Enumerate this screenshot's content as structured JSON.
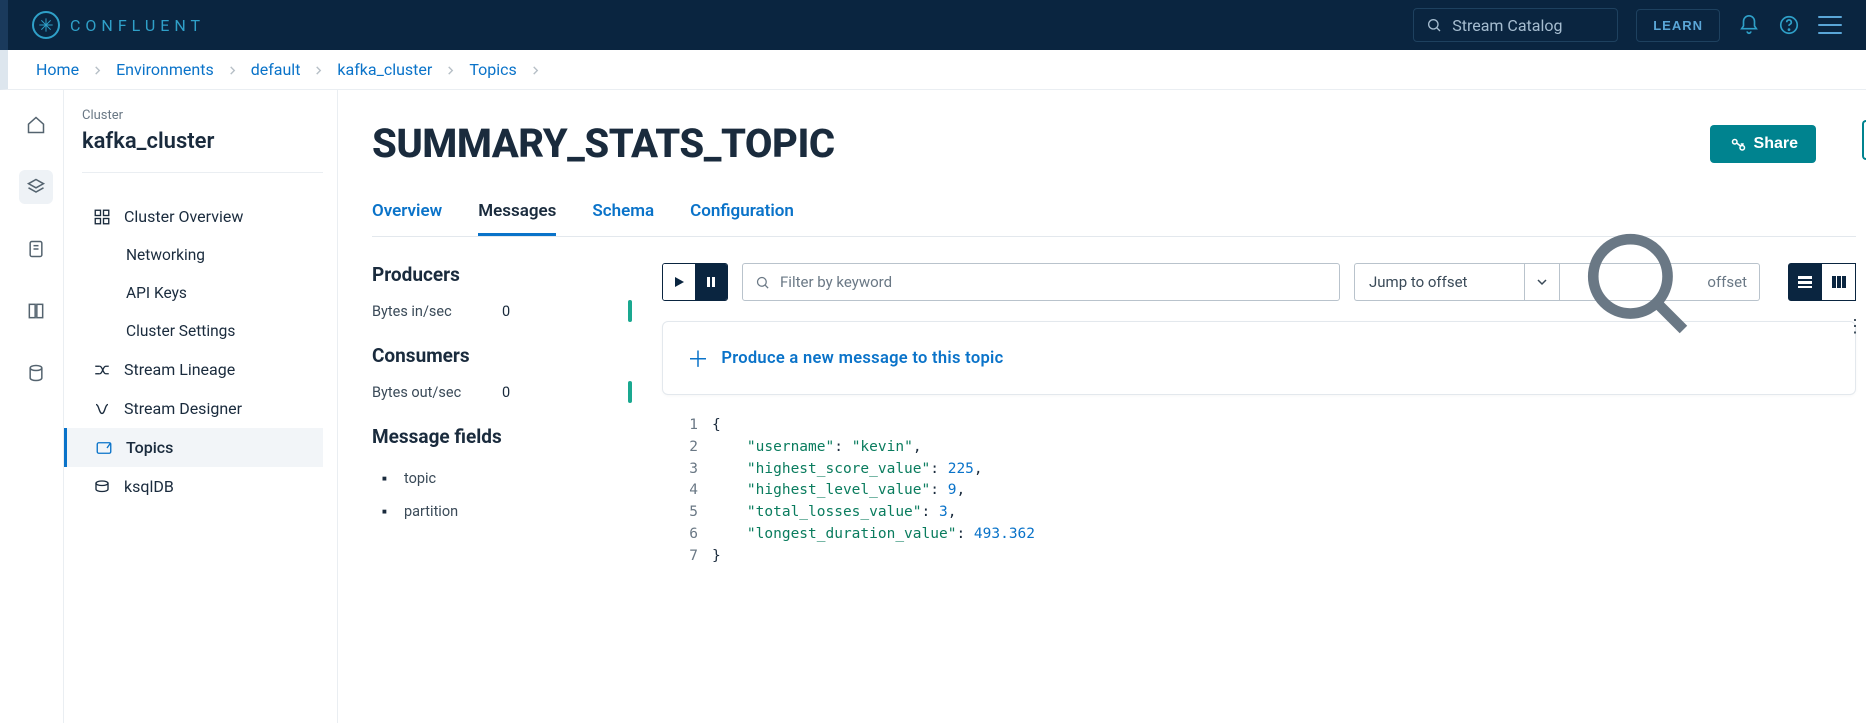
{
  "brand": "CONFLUENT",
  "search_placeholder": "Stream Catalog",
  "learn_btn": "LEARN",
  "breadcrumbs": [
    "Home",
    "Environments",
    "default",
    "kafka_cluster",
    "Topics"
  ],
  "sidebar": {
    "section_label": "Cluster",
    "cluster_name": "kafka_cluster",
    "items": {
      "overview": "Cluster Overview",
      "networking": "Networking",
      "apikeys": "API Keys",
      "settings": "Cluster Settings",
      "lineage": "Stream Lineage",
      "designer": "Stream Designer",
      "topics": "Topics",
      "ksqldb": "ksqlDB"
    }
  },
  "page": {
    "title": "SUMMARY_STATS_TOPIC",
    "share_label": "Share"
  },
  "tabs": {
    "overview": "Overview",
    "messages": "Messages",
    "schema": "Schema",
    "configuration": "Configuration"
  },
  "stats": {
    "producers_h": "Producers",
    "bytes_in_k": "Bytes in/sec",
    "bytes_in_v": "0",
    "consumers_h": "Consumers",
    "bytes_out_k": "Bytes out/sec",
    "bytes_out_v": "0",
    "msgfields_h": "Message fields",
    "fields": {
      "f0": "topic",
      "f1": "partition"
    }
  },
  "toolbar": {
    "filter_placeholder": "Filter by keyword",
    "jump_label": "Jump to offset",
    "offset_placeholder": "offset"
  },
  "produce_link": "Produce a new message to this topic",
  "message": {
    "lines": {
      "l1": "1",
      "l2": "2",
      "l3": "3",
      "l4": "4",
      "l5": "5",
      "l6": "6",
      "l7": "7"
    },
    "k_username": "\"username\"",
    "v_username": "\"kevin\"",
    "k_highscore": "\"highest_score_value\"",
    "v_highscore": "225",
    "k_highlevel": "\"highest_level_value\"",
    "v_highlevel": "9",
    "k_losses": "\"total_losses_value\"",
    "v_losses": "3",
    "k_duration": "\"longest_duration_value\"",
    "v_duration": "493.362"
  }
}
